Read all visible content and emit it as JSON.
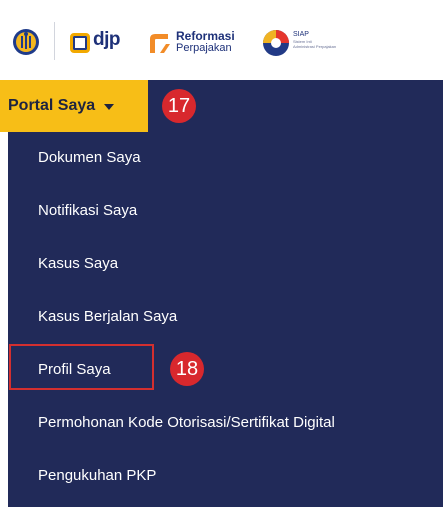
{
  "header": {
    "emblem_icon": "kemenkeu-emblem-icon",
    "djp_logo_text": "djp",
    "reformasi_line1": "Reformasi",
    "reformasi_line2": "Perpajakan",
    "siap_title": "SIAP",
    "siap_line1": "Sistem Inti",
    "siap_line2": "Administrasi Perpajakan"
  },
  "nav": {
    "portal_label": "Portal Saya",
    "portal_badge": "17"
  },
  "menu": {
    "items": [
      {
        "label": "Dokumen Saya"
      },
      {
        "label": "Notifikasi Saya"
      },
      {
        "label": "Kasus Saya"
      },
      {
        "label": "Kasus Berjalan Saya"
      },
      {
        "label": "Profil Saya"
      },
      {
        "label": "Permohonan Kode Otorisasi/Sertifikat Digital"
      },
      {
        "label": "Pengukuhan PKP"
      }
    ],
    "highlight_badge": "18"
  },
  "colors": {
    "nav_bg": "#212a59",
    "portal_bg": "#f7be17",
    "badge_bg": "#d8282d",
    "highlight_border": "#d32f2f"
  }
}
